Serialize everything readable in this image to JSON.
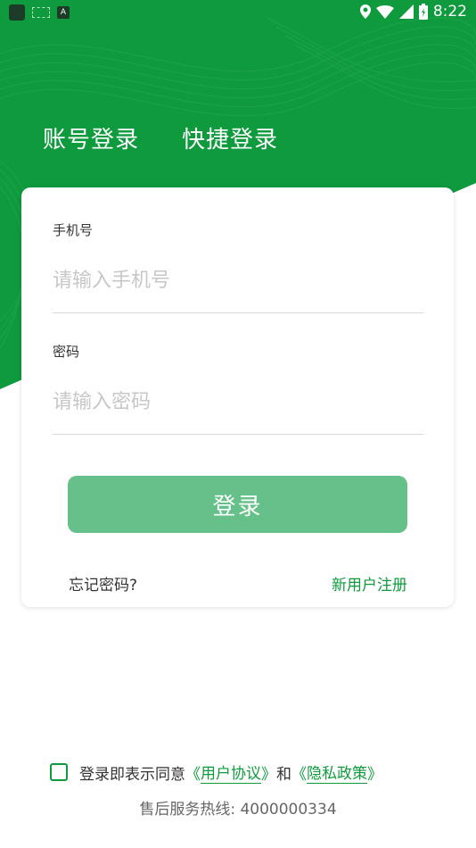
{
  "status_bar": {
    "time": "8:22",
    "app_icon_letter": "A"
  },
  "tabs": [
    {
      "label": "账号登录"
    },
    {
      "label": "快捷登录"
    }
  ],
  "form": {
    "phone_label": "手机号",
    "phone_placeholder": "请输入手机号",
    "phone_value": "",
    "password_label": "密码",
    "password_placeholder": "请输入密码",
    "password_value": ""
  },
  "buttons": {
    "login": "登录",
    "forgot": "忘记密码?",
    "register": "新用户注册"
  },
  "agreement": {
    "prefix": "登录即表示同意",
    "open_bracket": "《",
    "user_agreement": "用户协议",
    "close_bracket": "》",
    "and": "和",
    "privacy_policy": "隐私政策",
    "checked": false
  },
  "hotline": "售后服务热线: 4000000334",
  "colors": {
    "brand": "#0f9a3e",
    "button_disabled": "#66c089"
  }
}
